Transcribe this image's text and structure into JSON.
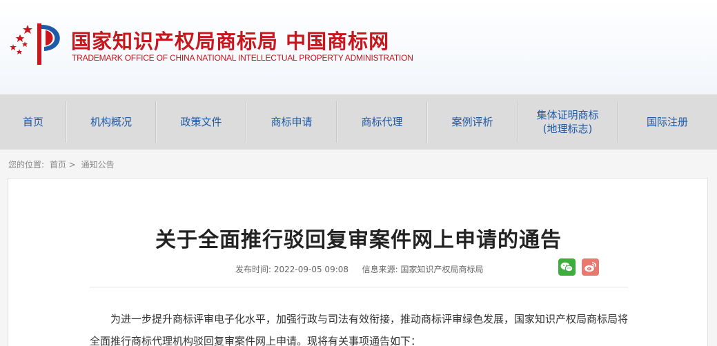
{
  "header": {
    "title_cn": "国家知识产权局商标局 中国商标网",
    "title_en": "TRADEMARK OFFICE OF CHINA NATIONAL INTELLECTUAL PROPERTY ADMINISTRATION"
  },
  "nav": {
    "items": [
      {
        "label": "首页"
      },
      {
        "label": "机构概况"
      },
      {
        "label": "政策文件"
      },
      {
        "label": "商标申请"
      },
      {
        "label": "商标代理"
      },
      {
        "label": "案例评析"
      },
      {
        "label": "集体证明商标\n(地理标志)"
      },
      {
        "label": "国际注册"
      }
    ]
  },
  "breadcrumb": {
    "prefix": "您的位置:",
    "home": "首页",
    "separator": ">",
    "current": "通知公告"
  },
  "article": {
    "title": "关于全面推行驳回复审案件网上申请的通告",
    "publish_label": "发布时间:",
    "publish_time": "2022-09-05 09:08",
    "source_label": "信息来源:",
    "source": "国家知识产权局商标局",
    "paragraph_1": "为进一步提升商标评审电子化水平，加强行政与司法有效衔接，推动商标评审绿色发展，国家知识产权局商标局将全面推行商标代理机构驳回复审案件网上申请。现将有关事项通告如下："
  },
  "colors": {
    "brand_red": "#c8161d",
    "nav_text": "#1d5aa8",
    "wechat": "#3dad3b",
    "weibo": "#e9786f"
  },
  "icons": {
    "share_wechat": "wechat-icon",
    "share_weibo": "weibo-icon"
  }
}
